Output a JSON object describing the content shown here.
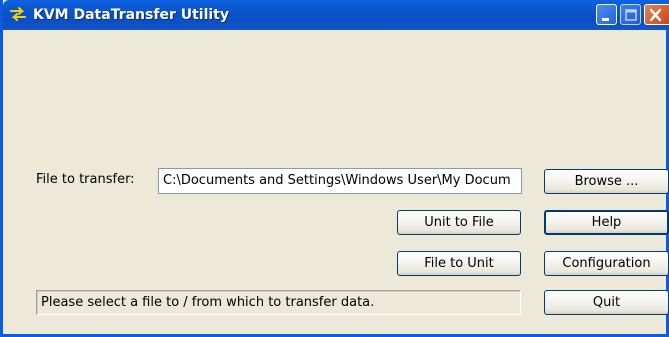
{
  "window": {
    "title": "KVM DataTransfer Utility",
    "title_icon": "transfer-arrows-icon",
    "controls": {
      "minimize_icon": "minimize-icon",
      "maximize_icon": "maximize-icon",
      "close_icon": "close-icon"
    }
  },
  "form": {
    "file_label": "File to transfer:",
    "file_path": "C:\\Documents and Settings\\Windows User\\My Docum"
  },
  "buttons": {
    "browse": "Browse ...",
    "unit_to_file": "Unit to File",
    "help": "Help",
    "file_to_unit": "File to Unit",
    "configuration": "Configuration",
    "quit": "Quit"
  },
  "status": {
    "message": "Please select a file to / from which to transfer data."
  },
  "colors": {
    "titlebar": "#0a52c9",
    "window_bg": "#ece9d8",
    "close_button": "#c8421a",
    "icon_arrows": "#f5d400"
  }
}
